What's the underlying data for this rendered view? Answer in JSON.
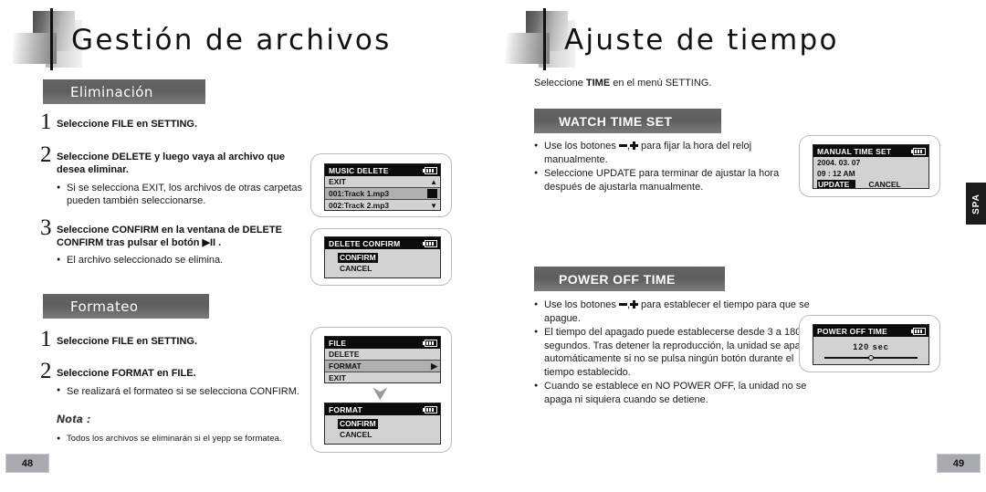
{
  "left_page": {
    "title": "Gestión de archivos",
    "page_number": "48",
    "sections": [
      {
        "heading": "Eliminación",
        "steps": [
          {
            "number": "1",
            "text": "Seleccione FILE en SETTING."
          },
          {
            "number": "2",
            "text": "Seleccione DELETE y luego vaya al archivo que desea eliminar.",
            "bullets": [
              "Si se selecciona EXIT, los archivos de otras carpetas pueden también seleccionarse."
            ]
          },
          {
            "number": "3",
            "text": "Seleccione CONFIRM en la ventana de DELETE CONFIRM tras pulsar el botón ▶II .",
            "bullets": [
              "El archivo seleccionado se elimina."
            ]
          }
        ]
      },
      {
        "heading": "Formateo",
        "steps": [
          {
            "number": "1",
            "text": "Seleccione FILE en SETTING."
          },
          {
            "number": "2",
            "text": "Seleccione FORMAT en FILE.",
            "bullets": [
              "Se realizará el formateo si se selecciona CONFIRM."
            ]
          }
        ],
        "note_title": "Nota :",
        "note_bullets": [
          "Todos los archivos se eliminarán si el yepp se formatea."
        ]
      }
    ],
    "screens": {
      "music_delete": {
        "title": "MUSIC DELETE",
        "rows": [
          {
            "label": "EXIT",
            "right": "▲",
            "selected": false
          },
          {
            "label": "001:Track 1.mp3",
            "right": "block",
            "selected": true
          },
          {
            "label": "002:Track 2.mp3",
            "right": "▼",
            "selected": false
          }
        ]
      },
      "delete_confirm": {
        "title": "DELETE CONFIRM",
        "items": [
          {
            "label": "CONFIRM",
            "highlighted": true
          },
          {
            "label": "CANCEL",
            "highlighted": false
          }
        ]
      },
      "file_menu": {
        "title": "FILE",
        "rows": [
          {
            "label": "DELETE",
            "right": "",
            "selected": false
          },
          {
            "label": "FORMAT",
            "right": "▶",
            "selected": true
          },
          {
            "label": "EXIT",
            "right": "",
            "selected": false
          }
        ]
      },
      "format_confirm": {
        "title": "FORMAT",
        "items": [
          {
            "label": "CONFIRM",
            "highlighted": true
          },
          {
            "label": "CANCEL",
            "highlighted": false
          }
        ]
      }
    }
  },
  "right_page": {
    "title": "Ajuste de tiempo",
    "page_number": "49",
    "intro_prefix": "Seleccione ",
    "intro_bold": "TIME",
    "intro_suffix": " en el menú SETTING.",
    "side_tab": "SPA",
    "sections": [
      {
        "heading": "WATCH TIME SET",
        "bullets": [
          {
            "pre": "Use los botones ",
            "glyphs": "minus-plus",
            "post": " para fijar la hora del reloj manualmente."
          },
          {
            "pre": "Seleccione UPDATE para terminar de ajustar la hora después de ajustarla manualmente.",
            "glyphs": "",
            "post": ""
          }
        ]
      },
      {
        "heading": "POWER OFF TIME",
        "bullets": [
          {
            "pre": "Use los botones ",
            "glyphs": "minus-plus",
            "post": " para establecer el tiempo para que se apague."
          },
          {
            "pre": "El tiempo del apagado puede establecerse desde 3 a 180 segundos. Tras detener la reproducción, la unidad se apaga automáticamente si no se pulsa ningún botón durante el tiempo establecido.",
            "glyphs": "",
            "post": ""
          },
          {
            "pre": "Cuando se establece en NO POWER OFF, la unidad no se apaga ni siquiera cuando se detiene.",
            "glyphs": "",
            "post": ""
          }
        ]
      }
    ],
    "screens": {
      "manual_time_set": {
        "title": "MANUAL TIME SET",
        "date": "2004. 03. 07",
        "time": "09 : 12  AM",
        "actions": [
          {
            "label": "UPDATE",
            "highlighted": true
          },
          {
            "label": "CANCEL",
            "highlighted": false
          }
        ]
      },
      "power_off_time": {
        "title": "POWER OFF TIME",
        "value": "120  sec",
        "slider_position_percent": 50
      }
    }
  }
}
